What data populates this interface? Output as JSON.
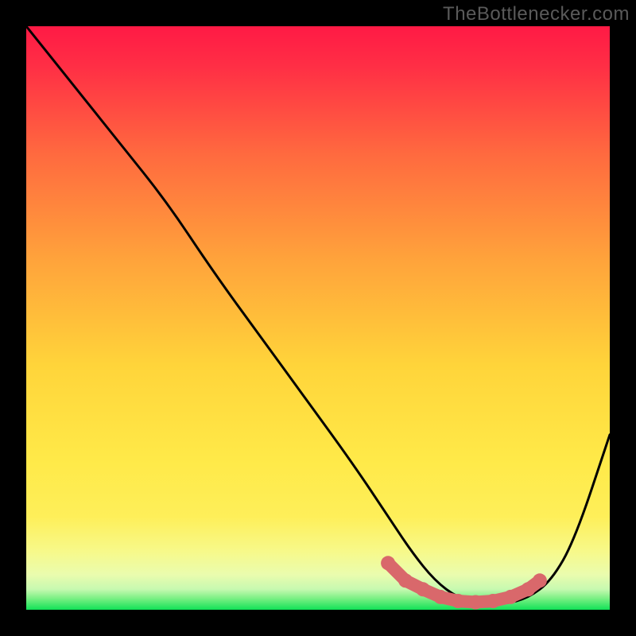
{
  "watermark": "TheBottlenecker.com",
  "colors": {
    "page_bg": "#000000",
    "curve": "#000000",
    "trough_marker": "#d9686b",
    "gradient": {
      "top": "#ff1a45",
      "midTop": "#ff7a3c",
      "mid": "#ffd43a",
      "lower": "#ffef57",
      "pale": "#f6fca8",
      "green": "#11e257"
    }
  },
  "chart_data": {
    "type": "line",
    "title": "",
    "xlabel": "",
    "ylabel": "",
    "xlim": [
      0,
      100
    ],
    "ylim": [
      0,
      100
    ],
    "grid": false,
    "legend": false,
    "series": [
      {
        "name": "bottleneck-curve",
        "x": [
          0,
          8,
          16,
          24,
          32,
          40,
          48,
          56,
          62,
          66,
          70,
          74,
          78,
          82,
          86,
          90,
          94,
          100
        ],
        "y": [
          100,
          90,
          80,
          70,
          58,
          47,
          36,
          25,
          16,
          10,
          5,
          2,
          1,
          1,
          2,
          5,
          12,
          30
        ]
      }
    ],
    "trough_marker": {
      "x": [
        62,
        65,
        68,
        71,
        74,
        77,
        80,
        83,
        86,
        88
      ],
      "y": [
        8,
        5,
        3.5,
        2.2,
        1.5,
        1.3,
        1.5,
        2.2,
        3.5,
        5
      ]
    },
    "note": "Values are estimated from unlabeled axes on a 0–100 normalized scale; curve shows mismatch/bottleneck magnitude decreasing to a minimum around x≈75–82 then rising."
  }
}
